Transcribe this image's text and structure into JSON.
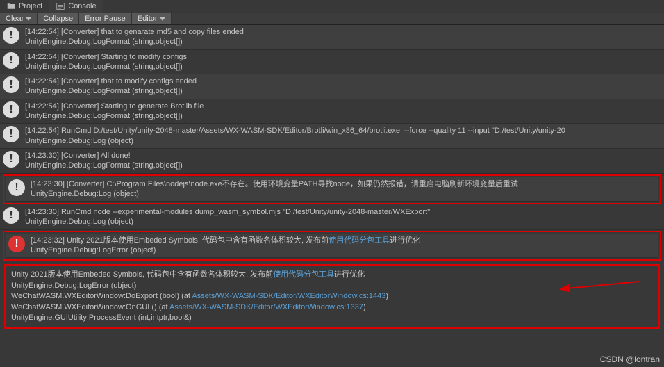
{
  "tabs": {
    "project": "Project",
    "console": "Console"
  },
  "toolbar": {
    "clear": "Clear",
    "collapse": "Collapse",
    "errorPause": "Error Pause",
    "editor": "Editor"
  },
  "logs": [
    {
      "t": "info",
      "l1": "[14:22:54] [Converter] that to genarate md5 and copy files ended",
      "l2": "UnityEngine.Debug:LogFormat (string,object[])"
    },
    {
      "t": "info",
      "l1": "[14:22:54] [Converter] Starting to modify configs",
      "l2": "UnityEngine.Debug:LogFormat (string,object[])"
    },
    {
      "t": "info",
      "l1": "[14:22:54] [Converter] that to modify configs ended",
      "l2": "UnityEngine.Debug:LogFormat (string,object[])"
    },
    {
      "t": "info",
      "l1": "[14:22:54] [Converter] Starting to generate Brotlib file",
      "l2": "UnityEngine.Debug:LogFormat (string,object[])"
    },
    {
      "t": "info",
      "l1": "[14:22:54] RunCmd D:/test/Unity/unity-2048-master/Assets/WX-WASM-SDK/Editor/Brotli/win_x86_64/brotli.exe  --force --quality 11 --input \"D:/test/Unity/unity-20",
      "l2": "UnityEngine.Debug:Log (object)"
    },
    {
      "t": "info",
      "l1": "[14:23:30] [Converter] All done!",
      "l2": "UnityEngine.Debug:LogFormat (string,object[])"
    },
    {
      "t": "info",
      "box": true,
      "l1": "[14:23:30] [Converter] C:\\Program Files\\nodejs\\node.exe不存在。使用环境变量PATH寻找node，如果仍然报错，请重启电脑刷新环境变量后重试",
      "l2": "UnityEngine.Debug:Log (object)"
    },
    {
      "t": "info",
      "l1": "[14:23:30] RunCmd node --experimental-modules dump_wasm_symbol.mjs \"D:/test/Unity/unity-2048-master/WXExport\"",
      "l2": "UnityEngine.Debug:Log (object)"
    },
    {
      "t": "err",
      "box": true,
      "l1": "[14:23:32] Unity 2021版本使用Embeded Symbols, 代码包中含有函数名体积较大, 发布前",
      "link": "使用代码分包工具",
      "l1b": "进行优化",
      "l2": "UnityEngine.Debug:LogError (object)"
    }
  ],
  "detail": {
    "d1a": "Unity 2021版本使用Embeded Symbols, 代码包中含有函数名体积较大, 发布前",
    "d1link": "使用代码分包工具",
    "d1b": "进行优化",
    "d2": "UnityEngine.Debug:LogError (object)",
    "d3a": "WeChatWASM.WXEditorWindow:DoExport (bool) (at ",
    "d3link": "Assets/WX-WASM-SDK/Editor/WXEditorWindow.cs:1443",
    "d3b": ")",
    "d4a": "WeChatWASM.WXEditorWindow:OnGUI () (at ",
    "d4link": "Assets/WX-WASM-SDK/Editor/WXEditorWindow.cs:1337",
    "d4b": ")",
    "d5": "UnityEngine.GUIUtility:ProcessEvent (int,intptr,bool&)"
  },
  "watermark": "CSDN @lontran"
}
